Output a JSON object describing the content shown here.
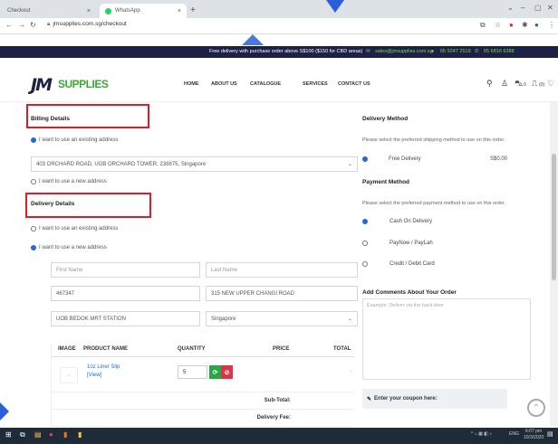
{
  "browser": {
    "tabs": [
      {
        "label": "Checkout"
      },
      {
        "label": "WhatsApp"
      }
    ],
    "url": "jmsupplies.com.sg/checkout"
  },
  "topbar": {
    "promo": "Free delivery with purchase order above S$100 ($150 for CBD areas)",
    "email": "sales@jmsupplies.com.sg",
    "phone1": "65 9247 2519",
    "phone2": "65 6816 6388"
  },
  "header": {
    "logo_jm": "JM",
    "logo_word": "SUPPLIES",
    "menu": [
      "HOME",
      "ABOUT US",
      "CATALOGUE",
      "SERVICES",
      "CONTACT US"
    ],
    "cart_count": "0",
    "wishlist_count": "(0)"
  },
  "billing": {
    "heading": "Billing Details",
    "existing_label": "I want to use an existing address",
    "existing_value": "403 ORCHARD ROAD, UOB ORCHARD TOWER, 238875, Singapore",
    "new_label": "I want to use a new address"
  },
  "delivery": {
    "heading": "Delivery Details",
    "existing_label": "I want to use an existing address",
    "new_label": "I want to use a new address",
    "first_name_placeholder": "First Name",
    "last_name_placeholder": "Last Name",
    "postal": "467347",
    "address": "315 NEW UPPER CHANGI ROAD",
    "address2": "UOB BEDOK MRT STATION",
    "country": "Singapore"
  },
  "cart": {
    "headers": [
      "IMAGE",
      "PRODUCT NAME",
      "QUANTITY",
      "PRICE",
      "TOTAL"
    ],
    "items": [
      {
        "name": "1oz Liner Slip",
        "view": "[View]",
        "qty": "5",
        "total": "-"
      }
    ],
    "subtotal_label": "Sub-Total:",
    "delivery_fee_label": "Delivery Fee:"
  },
  "delivery_method": {
    "heading": "Delivery Method",
    "note": "Please select the preferred shipping method to use on this order.",
    "option": "Free Delivery",
    "price": "S$0.00"
  },
  "payment_method": {
    "heading": "Payment Method",
    "note": "Please select the preferred payment method to use on this order.",
    "options": [
      "Cash On Delivery",
      "PayNow / PayLah",
      "Credit / Debit Card"
    ]
  },
  "comments": {
    "heading": "Add Comments About Your Order",
    "placeholder": "Example: Deliver via the back door"
  },
  "coupon": {
    "label": "Enter your coupon here:"
  },
  "taskbar": {
    "time": "6:07 pm",
    "date": "10/3/2020",
    "lang": "ENG"
  },
  "colors": {
    "navy": "#1d2145",
    "green": "#3aa935",
    "highlight": "#e31b23",
    "annotation": "#2b5fd9"
  }
}
